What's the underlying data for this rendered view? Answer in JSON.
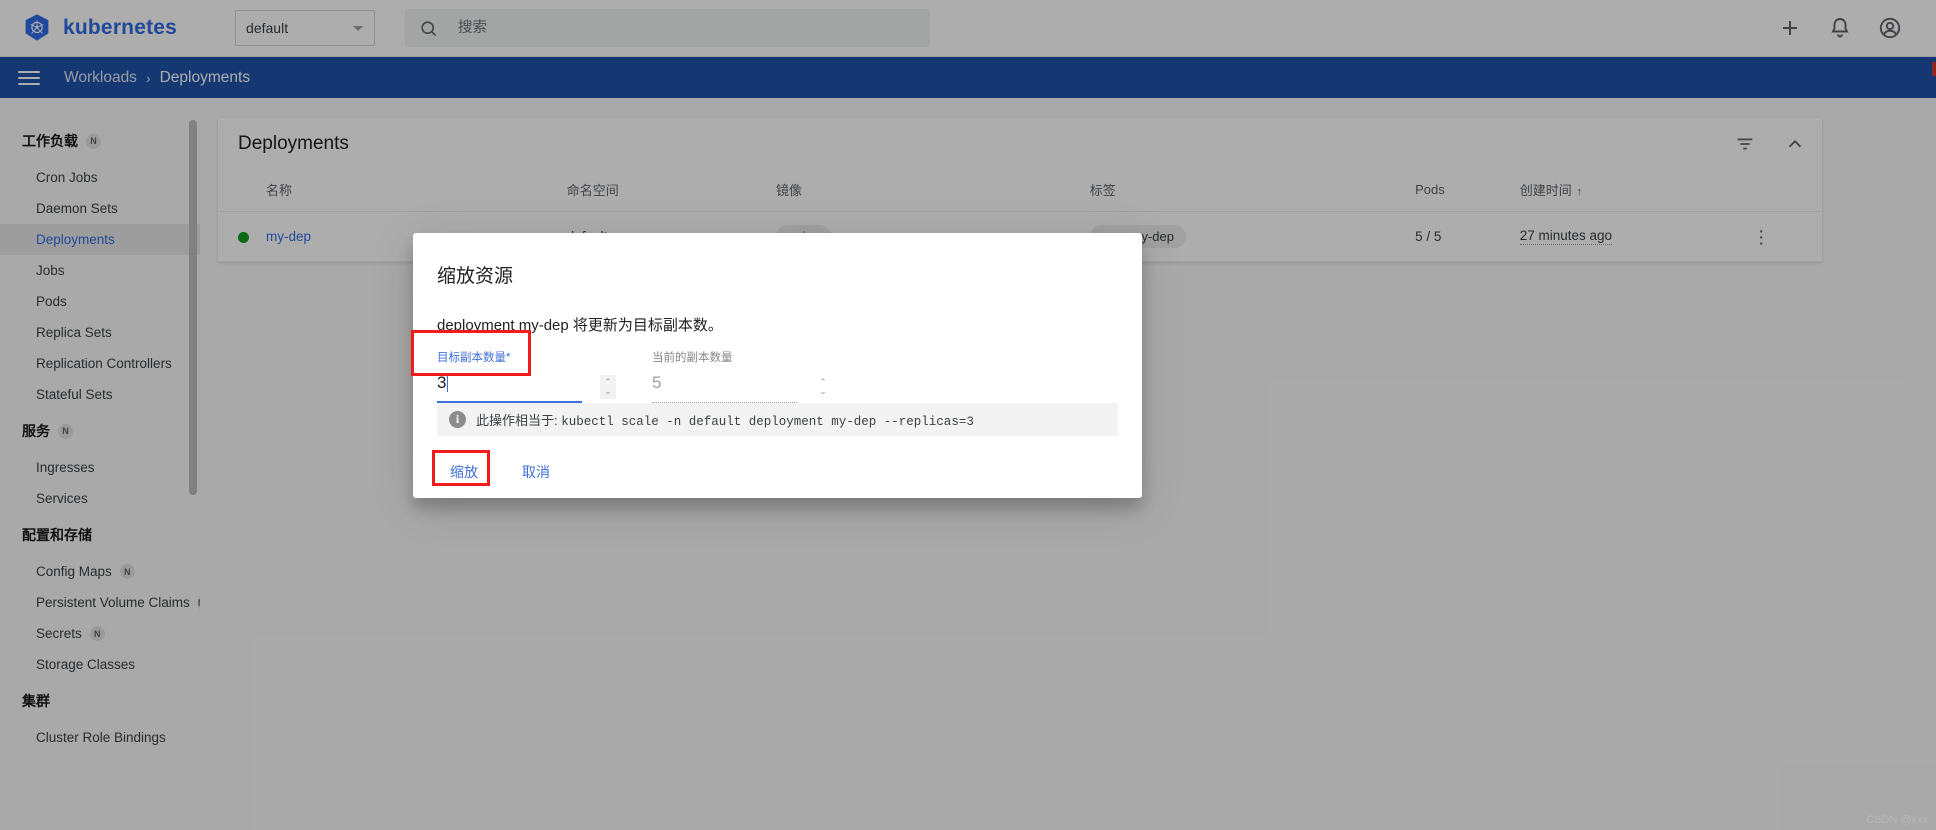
{
  "toolbar": {
    "brand": "kubernetes",
    "namespace_selected": "default",
    "search_placeholder": "搜索",
    "search_value": "",
    "icons": {
      "add": "add-icon",
      "notifications": "bell-icon",
      "account": "account-circle-icon"
    }
  },
  "breadcrumb": {
    "parent": "Workloads",
    "separator": "›",
    "current": "Deployments"
  },
  "sidebar": {
    "groups": [
      {
        "title": "工作负载",
        "badge": "N",
        "items": [
          {
            "label": "Cron Jobs",
            "badge": "",
            "active": false
          },
          {
            "label": "Daemon Sets",
            "badge": "",
            "active": false
          },
          {
            "label": "Deployments",
            "badge": "",
            "active": true
          },
          {
            "label": "Jobs",
            "badge": "",
            "active": false
          },
          {
            "label": "Pods",
            "badge": "",
            "active": false
          },
          {
            "label": "Replica Sets",
            "badge": "",
            "active": false
          },
          {
            "label": "Replication Controllers",
            "badge": "",
            "active": false
          },
          {
            "label": "Stateful Sets",
            "badge": "",
            "active": false
          }
        ]
      },
      {
        "title": "服务",
        "badge": "N",
        "items": [
          {
            "label": "Ingresses",
            "badge": "",
            "active": false
          },
          {
            "label": "Services",
            "badge": "",
            "active": false
          }
        ]
      },
      {
        "title": "配置和存储",
        "badge": "",
        "items": [
          {
            "label": "Config Maps",
            "badge": "N",
            "active": false
          },
          {
            "label": "Persistent Volume Claims",
            "badge": "N",
            "active": false
          },
          {
            "label": "Secrets",
            "badge": "N",
            "active": false
          },
          {
            "label": "Storage Classes",
            "badge": "",
            "active": false
          }
        ]
      },
      {
        "title": "集群",
        "badge": "",
        "items": [
          {
            "label": "Cluster Role Bindings",
            "badge": "",
            "active": false
          }
        ]
      }
    ]
  },
  "main": {
    "card_title": "Deployments",
    "actions": {
      "filter": "filter-icon",
      "collapse": "chevron-up-icon"
    },
    "columns": [
      {
        "key": "name",
        "label": "名称"
      },
      {
        "key": "namespace",
        "label": "命名空间"
      },
      {
        "key": "image",
        "label": "镜像"
      },
      {
        "key": "labels",
        "label": "标签"
      },
      {
        "key": "pods",
        "label": "Pods"
      },
      {
        "key": "created",
        "label": "创建时间"
      }
    ],
    "sort_indicator": "↑",
    "rows": [
      {
        "status": "running",
        "name": "my-dep",
        "namespace": "default",
        "image": "nginx",
        "labels": "app: my-dep",
        "pods": "5 / 5",
        "created": "27 minutes ago",
        "menu": "⋮"
      }
    ]
  },
  "dialog": {
    "title": "缩放资源",
    "description": "deployment my-dep 将更新为目标副本数。",
    "desired": {
      "label": "目标副本数量",
      "required_mark": "*",
      "value": "3"
    },
    "current": {
      "label": "当前的副本数量",
      "value": "5"
    },
    "spinner_up": "⌃",
    "spinner_down": "⌄",
    "info": {
      "icon": "info-icon",
      "prefix": "此操作相当于:",
      "command": "kubectl scale -n default deployment my-dep --replicas=3"
    },
    "confirm_label": "缩放",
    "cancel_label": "取消"
  },
  "watermark": "CSDN @xxx",
  "colors": {
    "brand_blue": "#326ce5",
    "header_blue": "#1f51a9",
    "link_blue": "#3f6fd8",
    "status_green": "#0f9d1f",
    "highlight_red": "#f01c1c"
  }
}
